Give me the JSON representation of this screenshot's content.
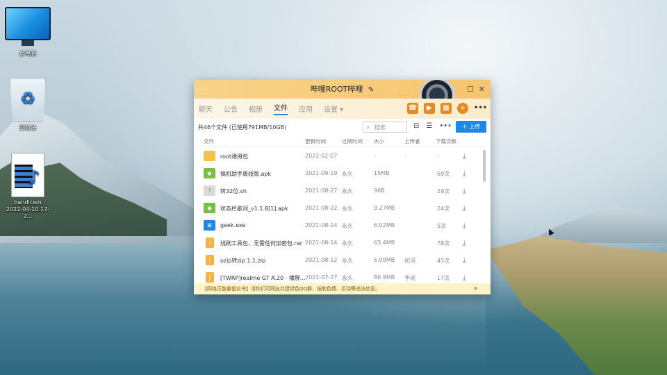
{
  "desktop": {
    "icons": [
      {
        "label": "此电脑",
        "icon": "computer-icon"
      },
      {
        "label": "回收站",
        "icon": "recycle-bin-icon"
      },
      {
        "label": "bandicam\n2022-04-10 17-2...",
        "icon": "video-file-icon"
      }
    ]
  },
  "window": {
    "title": "哔哩ROOT哔哩",
    "tabs": [
      {
        "label": "聊天"
      },
      {
        "label": "公告"
      },
      {
        "label": "相册"
      },
      {
        "label": "文件",
        "active": true
      },
      {
        "label": "应用"
      },
      {
        "label": "设置 ▾"
      }
    ],
    "summary": "共46个文件 (已使用791MB/10GB)",
    "search_placeholder": "搜索",
    "upload_label": "上传",
    "columns": [
      "文件",
      "更新时间",
      "过期时间",
      "大小",
      "上传者",
      "下载次数"
    ],
    "files": [
      {
        "name": "root通用包",
        "type": "folder",
        "date": "2022-02-07",
        "expire": "",
        "size": "-",
        "uploader": "-",
        "downloads": "-"
      },
      {
        "name": "搞机助手离线版.apk",
        "type": "apk",
        "date": "2021-09-19",
        "expire": "永久",
        "size": "15MB",
        "uploader": "",
        "downloads": "69次"
      },
      {
        "name": "转32位.sh",
        "type": "sh",
        "date": "2021-08-27",
        "expire": "永久",
        "size": "96B",
        "uploader": "",
        "downloads": "28次"
      },
      {
        "name": "状态栏歌词_v1.1.8[1].apk",
        "type": "apk",
        "date": "2021-08-22",
        "expire": "永久",
        "size": "9.27MB",
        "uploader": "",
        "downloads": "24次"
      },
      {
        "name": "geek.exe",
        "type": "exe",
        "date": "2021-08-14",
        "expire": "永久",
        "size": "6.02MB",
        "uploader": "",
        "downloads": "5次"
      },
      {
        "name": "线刷工具包，无需任何加密包.rar",
        "type": "zip",
        "date": "2021-08-14",
        "expire": "永久",
        "size": "63.4MB",
        "uploader": "",
        "downloads": "78次"
      },
      {
        "name": "ozip转zip 1.1.zip",
        "type": "zip",
        "date": "2021-08-12",
        "expire": "永久",
        "size": "6.09MB",
        "uploader": "初河",
        "downloads": "45次"
      },
      {
        "name": "[TWRP]realme GT A.20 · 横屏...",
        "type": "zip",
        "date": "2021-07-27",
        "expire": "永久",
        "size": "86.9MB",
        "uploader": "予诺",
        "downloads": "17次"
      }
    ],
    "notice": "【网络正能量倡议书】请你们可网友共建绿色QQ群，抵制色情、反动等违法信息。"
  }
}
